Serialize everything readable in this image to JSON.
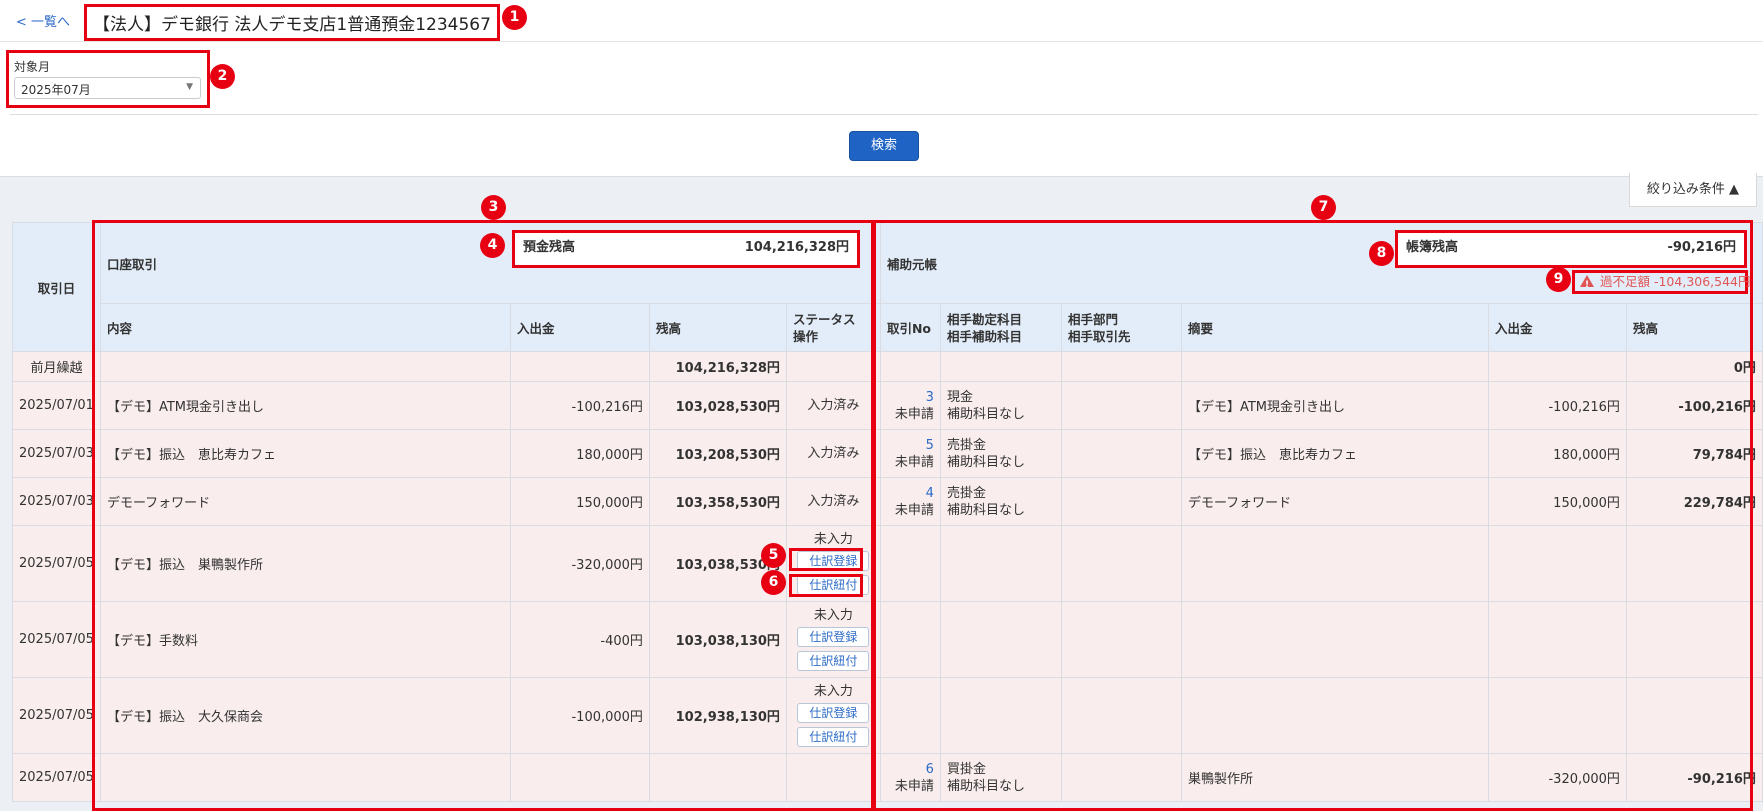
{
  "header": {
    "back_label": "< 一覧へ",
    "title": "【法人】デモ銀行 法人デモ支店1普通預金1234567"
  },
  "filter": {
    "label": "対象月",
    "month_value": "2025年07月",
    "search_label": "検索",
    "toggle_label": "絞り込み条件 ▲"
  },
  "badges": [
    "1",
    "2",
    "3",
    "4",
    "5",
    "6",
    "7",
    "8",
    "9"
  ],
  "table": {
    "date_header": "取引日",
    "bank_header": "口座取引",
    "bank_balance_label": "預金残高",
    "bank_balance_value": "104,216,328円",
    "ledger_header": "補助元帳",
    "ledger_balance_label": "帳簿残高",
    "ledger_balance_value": "-90,216円",
    "diff_text": "過不足額 -104,306,544円",
    "columns": {
      "content": "内容",
      "amount": "入出金",
      "balance": "残高",
      "status_line1": "ステータス",
      "status_line2": "操作",
      "tx_no": "取引No",
      "account_line1": "相手勘定科目",
      "account_line2": "相手補助科目",
      "dept_line1": "相手部門",
      "dept_line2": "相手取引先",
      "memo": "摘要",
      "ledger_amount": "入出金",
      "ledger_balance": "残高"
    },
    "rows": [
      {
        "date": "前月繰越",
        "content": "",
        "amount": "",
        "balance": "104,216,328円",
        "status": "",
        "tx_no": "",
        "tx_state": "",
        "account": "",
        "sub_account": "",
        "dept": "",
        "memo": "",
        "l_amount": "",
        "l_balance": "0円"
      },
      {
        "date": "2025/07/01",
        "content": "【デモ】ATM現金引き出し",
        "amount": "-100,216円",
        "balance": "103,028,530円",
        "status": "入力済み",
        "tx_no": "3",
        "tx_state": "未申請",
        "account": "現金",
        "sub_account": "補助科目なし",
        "dept": "",
        "memo": "【デモ】ATM現金引き出し",
        "l_amount": "-100,216円",
        "l_balance": "-100,216円"
      },
      {
        "date": "2025/07/03",
        "content": "【デモ】振込　恵比寿カフェ",
        "amount": "180,000円",
        "balance": "103,208,530円",
        "status": "入力済み",
        "tx_no": "5",
        "tx_state": "未申請",
        "account": "売掛金",
        "sub_account": "補助科目なし",
        "dept": "",
        "memo": "【デモ】振込　恵比寿カフェ",
        "l_amount": "180,000円",
        "l_balance": "79,784円"
      },
      {
        "date": "2025/07/03",
        "content": "デモーフォワード",
        "amount": "150,000円",
        "balance": "103,358,530円",
        "status": "入力済み",
        "tx_no": "4",
        "tx_state": "未申請",
        "account": "売掛金",
        "sub_account": "補助科目なし",
        "dept": "",
        "memo": "デモーフォワード",
        "l_amount": "150,000円",
        "l_balance": "229,784円"
      },
      {
        "date": "2025/07/05",
        "content": "【デモ】振込　巣鴨製作所",
        "amount": "-320,000円",
        "balance": "103,038,530円",
        "status": "未入力",
        "btn_register": "仕訳登録",
        "btn_link": "仕訳紐付",
        "tx_no": "",
        "tx_state": "",
        "account": "",
        "sub_account": "",
        "dept": "",
        "memo": "",
        "l_amount": "",
        "l_balance": ""
      },
      {
        "date": "2025/07/05",
        "content": "【デモ】手数料",
        "amount": "-400円",
        "balance": "103,038,130円",
        "status": "未入力",
        "btn_register": "仕訳登録",
        "btn_link": "仕訳紐付",
        "tx_no": "",
        "tx_state": "",
        "account": "",
        "sub_account": "",
        "dept": "",
        "memo": "",
        "l_amount": "",
        "l_balance": ""
      },
      {
        "date": "2025/07/05",
        "content": "【デモ】振込　大久保商会",
        "amount": "-100,000円",
        "balance": "102,938,130円",
        "status": "未入力",
        "btn_register": "仕訳登録",
        "btn_link": "仕訳紐付",
        "tx_no": "",
        "tx_state": "",
        "account": "",
        "sub_account": "",
        "dept": "",
        "memo": "",
        "l_amount": "",
        "l_balance": ""
      },
      {
        "date": "2025/07/05",
        "content": "",
        "amount": "",
        "balance": "",
        "status": "",
        "tx_no": "6",
        "tx_state": "未申請",
        "account": "買掛金",
        "sub_account": "補助科目なし",
        "dept": "",
        "memo": "巣鴨製作所",
        "l_amount": "-320,000円",
        "l_balance": "-90,216円"
      }
    ]
  }
}
